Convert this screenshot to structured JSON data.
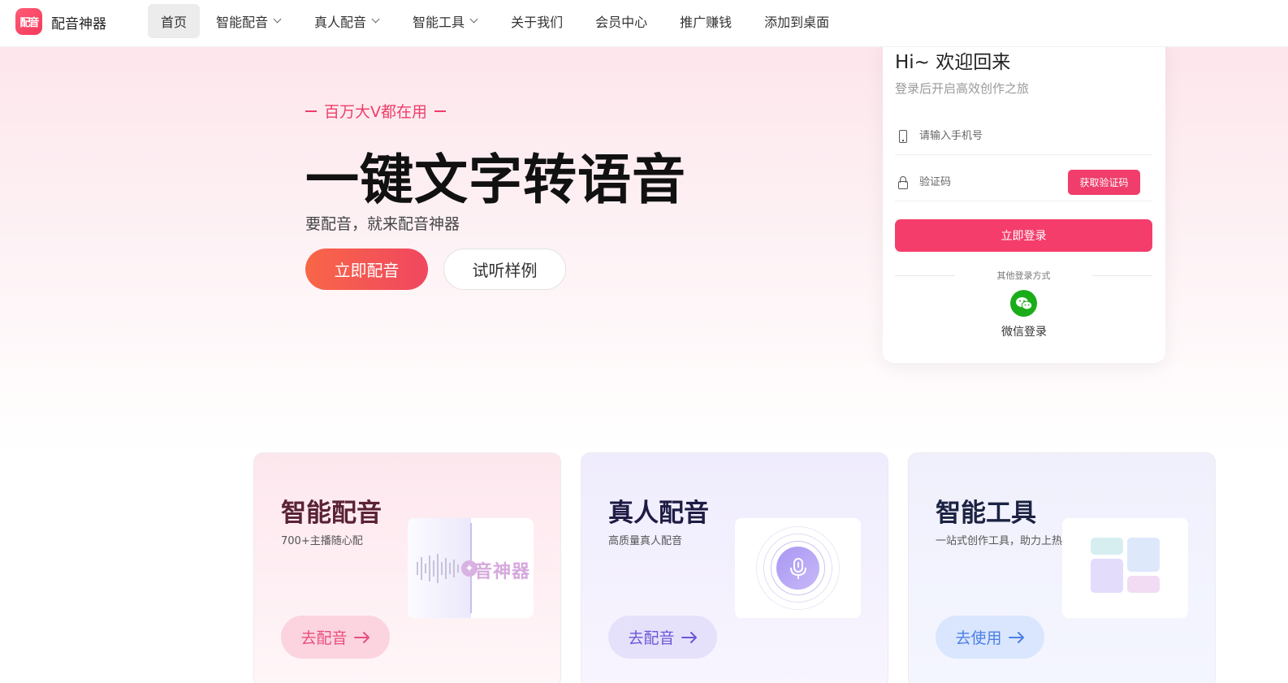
{
  "brand": {
    "name": "配音神器",
    "logo_text": "配音",
    "logo_color": "#f53a5c"
  },
  "nav": {
    "items": [
      {
        "label": "首页",
        "active": true,
        "dropdown": false
      },
      {
        "label": "智能配音",
        "active": false,
        "dropdown": true
      },
      {
        "label": "真人配音",
        "active": false,
        "dropdown": true
      },
      {
        "label": "智能工具",
        "active": false,
        "dropdown": true
      },
      {
        "label": "关于我们",
        "active": false,
        "dropdown": false
      },
      {
        "label": "会员中心",
        "active": false,
        "dropdown": false
      },
      {
        "label": "推广赚钱",
        "active": false,
        "dropdown": false
      },
      {
        "label": "添加到桌面",
        "active": false,
        "dropdown": false
      }
    ]
  },
  "hero": {
    "tagline": "百万大V都在用",
    "headline": "一键文字转语音",
    "subline": "要配音，就来配音神器",
    "primary_button": "立即配音",
    "secondary_button": "试听样例",
    "accent_color": "#ef3e68"
  },
  "login": {
    "title": "Hi~ 欢迎回来",
    "subtitle": "登录后开启高效创作之旅",
    "phone_placeholder": "请输入手机号",
    "code_placeholder": "验证码",
    "get_code_button": "获取验证码",
    "submit_button": "立即登录",
    "other_methods": "其他登录方式",
    "wechat_label": "微信登录",
    "wechat_icon": "wechat-icon",
    "wechat_color": "#1aad19"
  },
  "cards": [
    {
      "title": "智能配音",
      "desc": "700+主播随心配",
      "button": "去配音",
      "art_text": "音神器",
      "accent": "#ea4f7e"
    },
    {
      "title": "真人配音",
      "desc": "高质量真人配音",
      "button": "去配音",
      "art_icon": "microphone-icon",
      "accent": "#6a58d6"
    },
    {
      "title": "智能工具",
      "desc": "一站式创作工具，助力上热门",
      "button": "去使用",
      "art_icon": "grid-tiles-icon",
      "accent": "#4d7fe6"
    }
  ]
}
